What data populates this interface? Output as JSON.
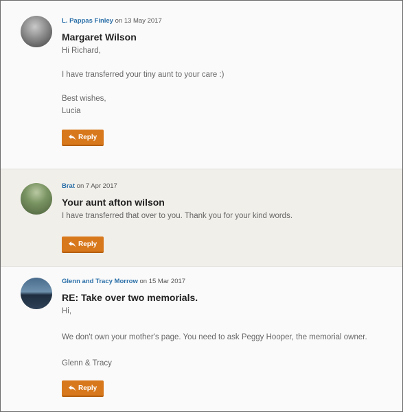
{
  "messages": [
    {
      "author": "L. Pappas Finley",
      "date_text": " on 13 May 2017",
      "subject": "Margaret Wilson",
      "lines": [
        "Hi Richard,",
        "I have transferred your tiny aunt to your care :)",
        "Best wishes,",
        "Lucia"
      ],
      "reply_label": "Reply"
    },
    {
      "author": "Brat",
      "date_text": " on 7 Apr 2017",
      "subject": "Your aunt afton wilson",
      "lines": [
        "I have transferred that over to you. Thank you for your kind words."
      ],
      "reply_label": "Reply"
    },
    {
      "author": "Glenn and Tracy Morrow",
      "date_text": " on 15 Mar 2017",
      "subject": "RE: Take over two memorials.",
      "lines": [
        "Hi,",
        "We don't own your mother's page. You need to ask Peggy Hooper, the memorial owner.",
        "Glenn & Tracy"
      ],
      "reply_label": "Reply"
    }
  ],
  "colors": {
    "accent": "#d8781c",
    "link": "#2a6fa8",
    "alt_row": "#f1efea"
  },
  "icons": {
    "reply": "reply-arrow-icon"
  }
}
